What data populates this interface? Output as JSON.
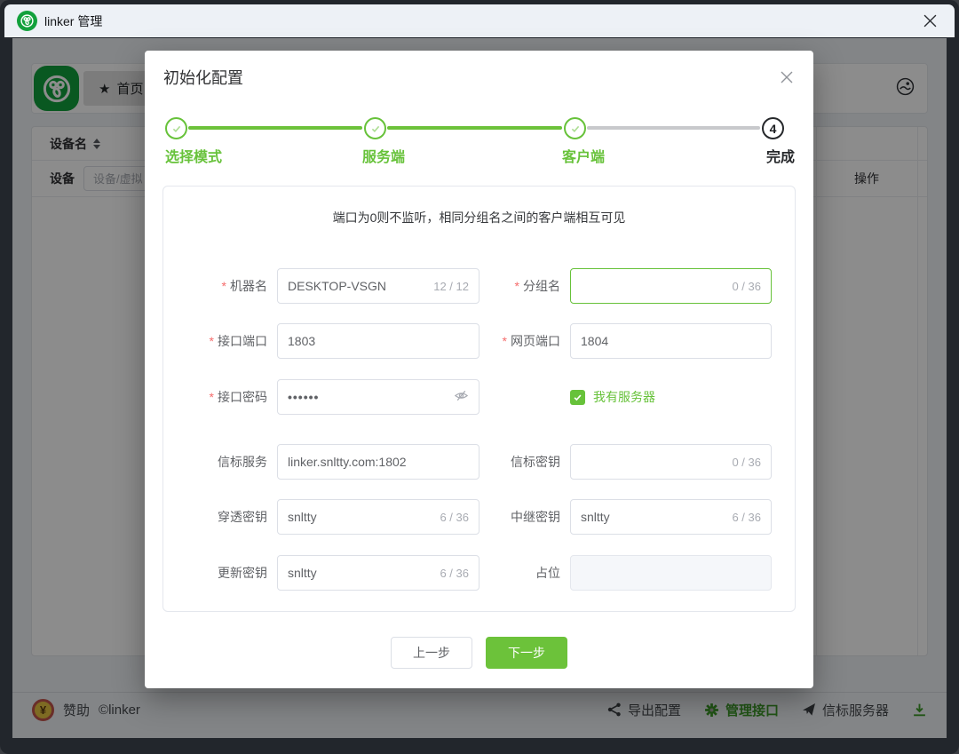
{
  "colors": {
    "accent_green": "#67c23a",
    "required_red": "#f56c6c",
    "step_inactive_line": "#c8c9cc",
    "logo_green": "#12a13c"
  },
  "window": {
    "title": "linker 管理"
  },
  "app": {
    "tab": {
      "star": "★",
      "label": "首页"
    },
    "table": {
      "device_name_header": "设备名",
      "device_label": "设备",
      "device_placeholder": "设备/虚拟",
      "action_header": "操作"
    },
    "footer": {
      "currency": "¥",
      "sponsor": "赞助",
      "copyright": "©linker",
      "export_config": "导出配置",
      "manage_api": "管理接口",
      "beacon_server": "信标服务器"
    }
  },
  "modal": {
    "title": "初始化配置",
    "required_mark": "*",
    "steps": [
      {
        "label": "选择模式"
      },
      {
        "label": "服务端"
      },
      {
        "label": "客户端"
      },
      {
        "label": "完成",
        "number": "4"
      }
    ],
    "hint": "端口为0则不监听，相同分组名之间的客户端相互可见",
    "fields": {
      "machine_name": {
        "label": "机器名",
        "value": "DESKTOP-VSGN",
        "counter": "12 / 12"
      },
      "group_name": {
        "label": "分组名",
        "value": "",
        "counter": "0 / 36"
      },
      "api_port": {
        "label": "接口端口",
        "value": "1803"
      },
      "web_port": {
        "label": "网页端口",
        "value": "1804"
      },
      "api_password": {
        "label": "接口密码",
        "value": "••••••"
      },
      "have_server": {
        "label": "我有服务器",
        "checked": true
      },
      "beacon_service": {
        "label": "信标服务",
        "value": "linker.snltty.com:1802"
      },
      "beacon_key": {
        "label": "信标密钥",
        "value": "",
        "counter": "0 / 36"
      },
      "punch_key": {
        "label": "穿透密钥",
        "value": "snltty",
        "counter": "6 / 36"
      },
      "relay_key": {
        "label": "中继密钥",
        "value": "snltty",
        "counter": "6 / 36"
      },
      "update_key": {
        "label": "更新密钥",
        "value": "snltty",
        "counter": "6 / 36"
      },
      "placeholder_field": {
        "label": "占位",
        "value": ""
      }
    },
    "buttons": {
      "prev": "上一步",
      "next": "下一步"
    }
  }
}
